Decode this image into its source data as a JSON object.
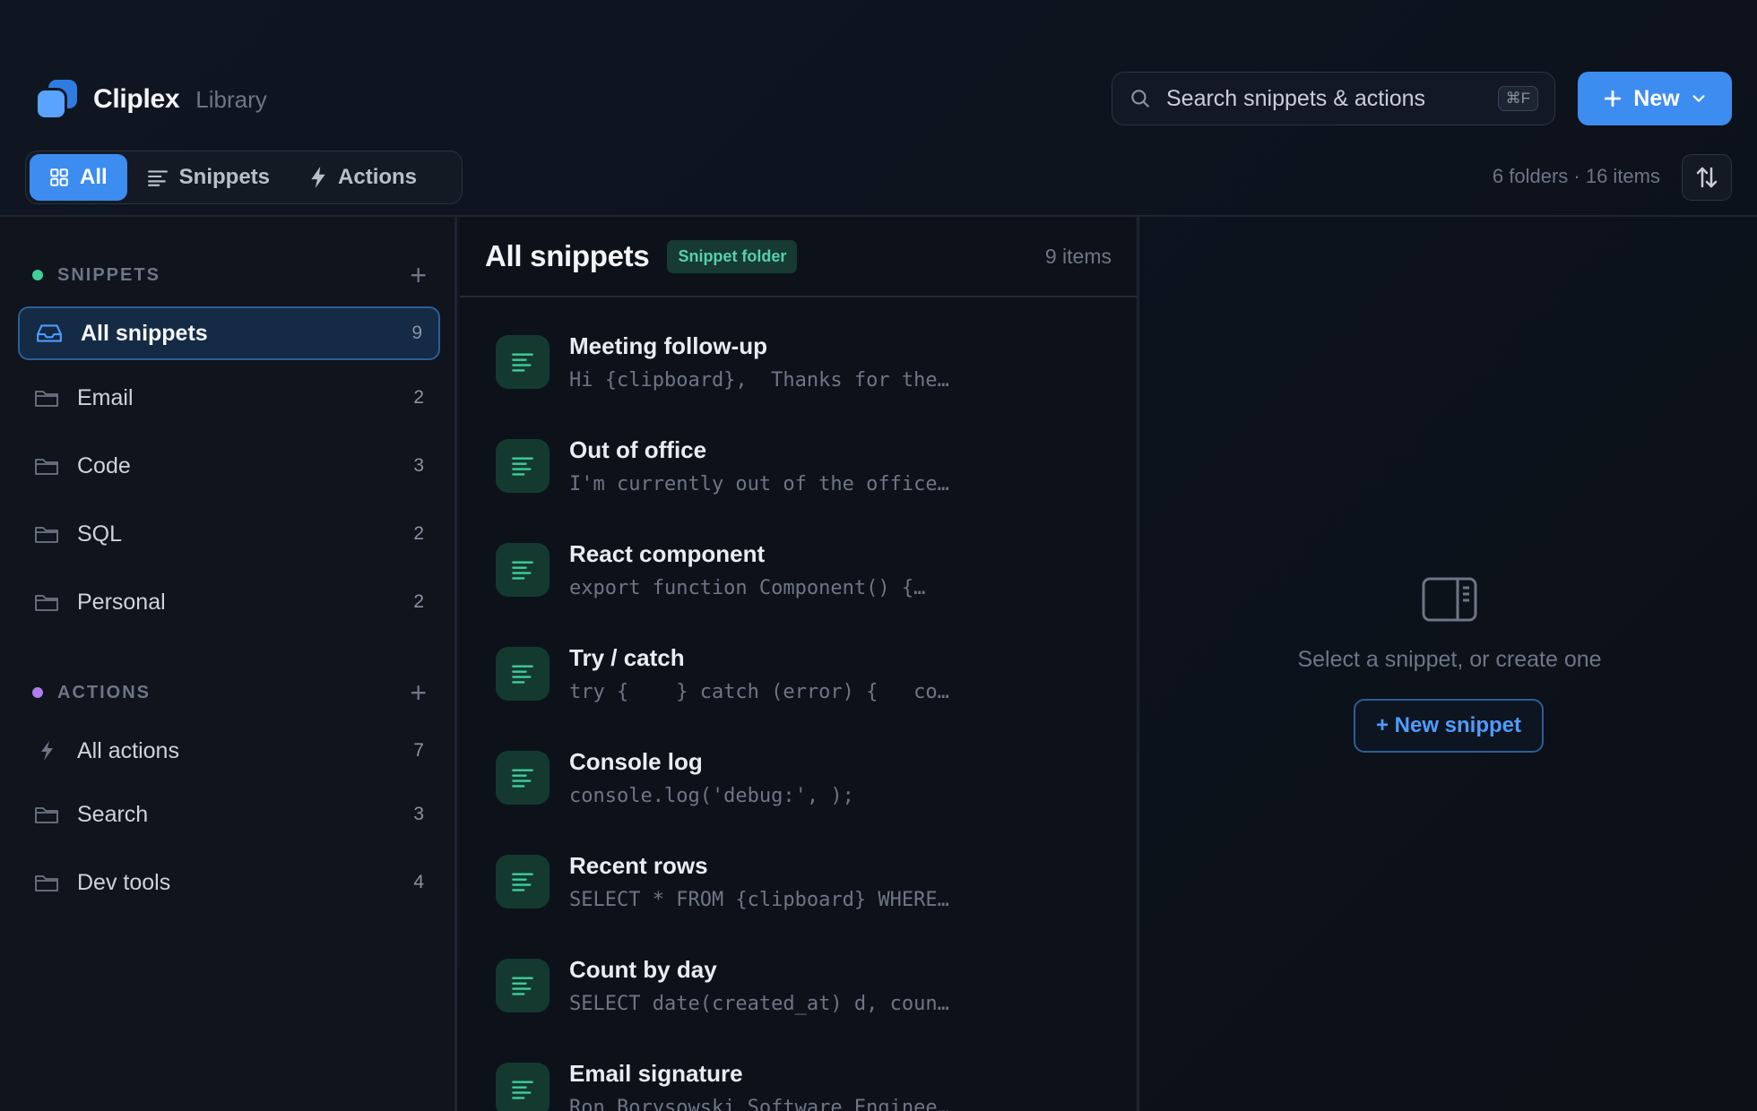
{
  "app": {
    "name": "Cliplex",
    "section": "Library"
  },
  "search": {
    "placeholder": "Search snippets & actions",
    "shortcut": "⌘F"
  },
  "new_button": {
    "label": "New"
  },
  "tabs": [
    {
      "label": "All",
      "icon": "grid-icon",
      "active": true
    },
    {
      "label": "Snippets",
      "icon": "lines-icon",
      "active": false
    },
    {
      "label": "Actions",
      "icon": "bolt-icon",
      "active": false
    }
  ],
  "stats": "6 folders · 16 items",
  "sidebar": {
    "snippets_section": {
      "title": "SNIPPETS",
      "dot_color": "#3ecf9b",
      "items": [
        {
          "label": "All snippets",
          "count": "9",
          "icon": "inbox-icon",
          "active": true
        },
        {
          "label": "Email",
          "count": "2",
          "icon": "folder-icon"
        },
        {
          "label": "Code",
          "count": "3",
          "icon": "folder-icon"
        },
        {
          "label": "SQL",
          "count": "2",
          "icon": "folder-icon"
        },
        {
          "label": "Personal",
          "count": "2",
          "icon": "folder-icon"
        }
      ]
    },
    "actions_section": {
      "title": "ACTIONS",
      "dot_color": "#b07cf0",
      "items": [
        {
          "label": "All actions",
          "count": "7",
          "icon": "bolt-icon"
        },
        {
          "label": "Search",
          "count": "3",
          "icon": "folder-icon"
        },
        {
          "label": "Dev tools",
          "count": "4",
          "icon": "folder-icon"
        }
      ]
    }
  },
  "list": {
    "title": "All snippets",
    "badge": "Snippet folder",
    "count": "9 items",
    "items": [
      {
        "title": "Meeting follow-up",
        "preview": "Hi {clipboard},  Thanks for the…"
      },
      {
        "title": "Out of office",
        "preview": "I'm currently out of the office…"
      },
      {
        "title": "React component",
        "preview": "export function Component() {…"
      },
      {
        "title": "Try / catch",
        "preview": "try {    } catch (error) {   co…"
      },
      {
        "title": "Console log",
        "preview": "console.log('debug:', );"
      },
      {
        "title": "Recent rows",
        "preview": "SELECT * FROM {clipboard} WHERE…"
      },
      {
        "title": "Count by day",
        "preview": "SELECT date(created_at) d, coun…"
      },
      {
        "title": "Email signature",
        "preview": "Ron Borysowski Software Enginee…"
      }
    ]
  },
  "detail": {
    "empty_text": "Select a snippet, or create one",
    "new_snippet_label": "+ New snippet"
  },
  "colors": {
    "accent": "#3d8cf0",
    "snippet_green": "#3ecf9b",
    "action_purple": "#b07cf0"
  }
}
